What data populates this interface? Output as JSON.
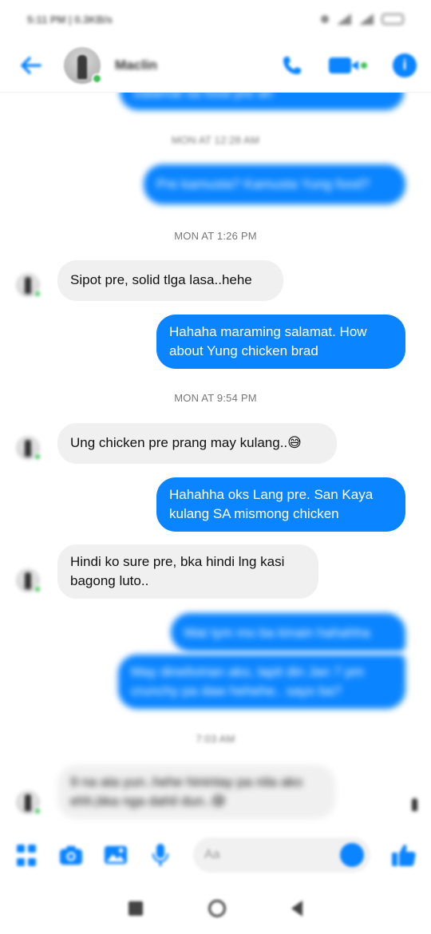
{
  "status_bar": {
    "time": "5:11 PM | 0.3KB/s"
  },
  "header": {
    "contact_name": "Maclin"
  },
  "timestamps": {
    "t1": "MON AT 12:28 AM",
    "t2": "MON AT 1:26 PM",
    "t3": "MON AT 9:54 PM",
    "t4": "7:03 AM"
  },
  "messages": {
    "m0": "Salamat sa food pre ah",
    "m1": "Pre kamusta? Kamusta Yung food?",
    "m2": "Sipot pre, solid tlga lasa..hehe",
    "m3a": "Hahaha maraming salamat. How",
    "m3b": "about Yung chicken brad",
    "m4": "Ung chicken pre prang may kulang..😅",
    "m5a": "Hahahha oks Lang pre. San Kaya",
    "m5b": "kulang SA mismong chicken",
    "m6a": "Hindi ko sure pre, bka hindi lng kasi",
    "m6b": "bagong luto..",
    "m7": "Wat tym mo ba kinain hahahha",
    "m8a": "May dinelivirian ako, lapit din Jan 7 pm",
    "m8b": "crunchy pa daw hehehe.. sayo ba?",
    "m9a": "9 na ata yun..hehe hinintay pa nila ako",
    "m9b": "ehh,bka nga dahil dun..😅"
  },
  "composer": {
    "placeholder": "Aa"
  },
  "colors": {
    "accent": "#0a84ff",
    "online": "#3fbf55",
    "incoming": "#f0f0f0"
  }
}
